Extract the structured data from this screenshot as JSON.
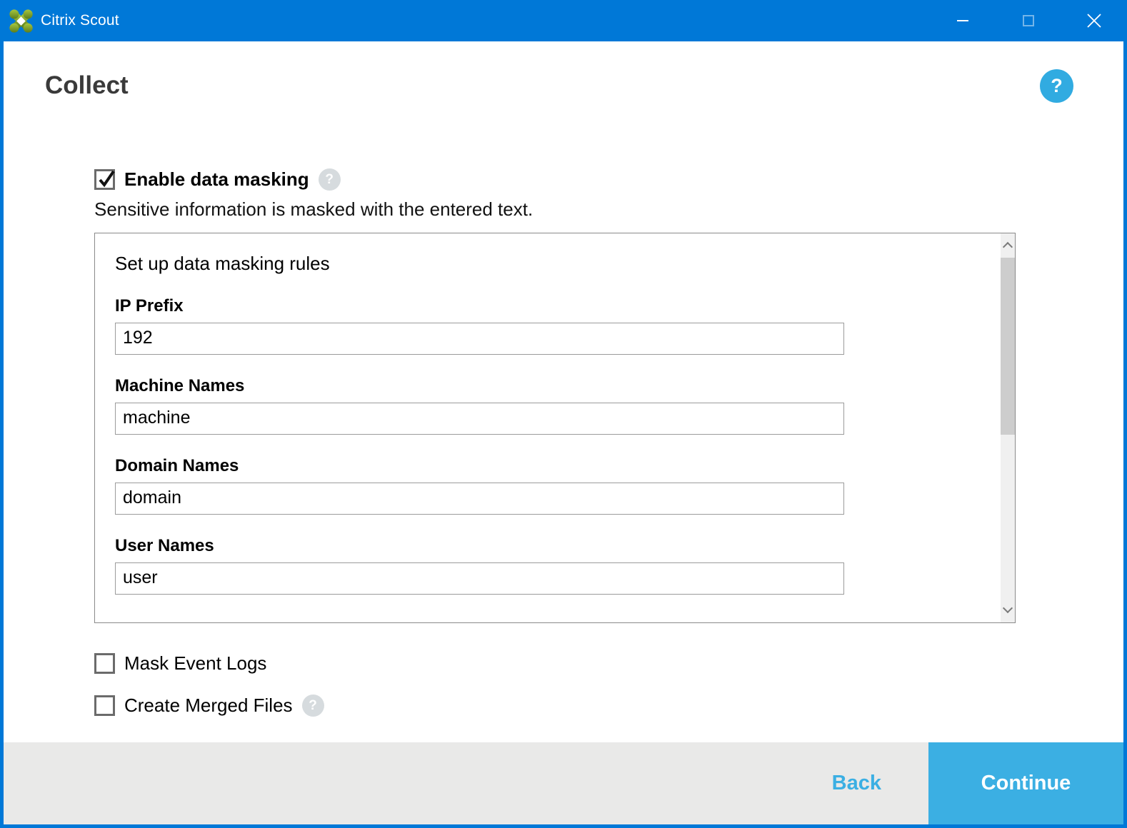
{
  "window": {
    "title": "Citrix Scout",
    "controls": {
      "minimize": "minimize",
      "maximize": "maximize",
      "close": "close"
    }
  },
  "header": {
    "title": "Collect"
  },
  "icons": {
    "help_glyph": "?"
  },
  "masking": {
    "enable_label": "Enable data masking",
    "enable_checked": true,
    "description": "Sensitive information is masked with the entered text.",
    "panel": {
      "title": "Set up data masking rules",
      "fields": [
        {
          "label": "IP Prefix",
          "value": "192"
        },
        {
          "label": "Machine Names",
          "value": "machine"
        },
        {
          "label": "Domain Names",
          "value": "domain"
        },
        {
          "label": "User Names",
          "value": "user"
        }
      ]
    }
  },
  "options": [
    {
      "label": "Mask Event Logs",
      "checked": false
    },
    {
      "label": "Create Merged Files",
      "checked": false
    }
  ],
  "footer": {
    "back_label": "Back",
    "continue_label": "Continue"
  },
  "colors": {
    "titlebar_blue": "#0078D7",
    "accent_blue": "#3BAFE3",
    "footer_gray": "#E9E9E8",
    "logo_green": "#7BA024"
  }
}
